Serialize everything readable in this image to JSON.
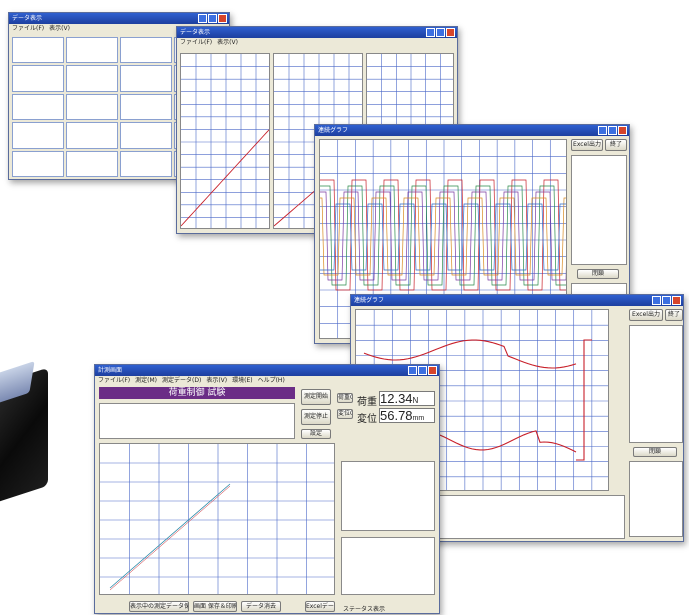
{
  "colors": {
    "title_blue": "#1d3f9f",
    "banner_purple": "#6b2d86",
    "line_red": "#c8202a",
    "line_green": "#2a8a4a",
    "grid_blue": "#4a68c8"
  },
  "win1": {
    "title": "データ表示",
    "menu": [
      "ファイル(F)",
      "表示(V)"
    ]
  },
  "win2": {
    "title": "データ表示",
    "menu": [
      "ファイル(F)",
      "表示(V)"
    ]
  },
  "win3": {
    "title": "連続グラフ",
    "excel_button": "Excel出力",
    "end_button": "終了",
    "apply_button": "閉鎖"
  },
  "win4": {
    "title": "連続グラフ",
    "excel_button": "Excel出力",
    "end_button": "終了",
    "apply_button": "閉鎖"
  },
  "win5": {
    "title": "計測画面",
    "menu": [
      "ファイル(F)",
      "測定(M)",
      "測定データ(D)",
      "表示(V)",
      "環境(E)",
      "ヘルプ(H)"
    ],
    "banner": "荷重制御 試験",
    "buttons": {
      "start": "測定開始",
      "stop": "測定停止",
      "zero1": "荷重0",
      "zero2": "変位0",
      "settings": "設定",
      "save": "表示中の測定データ保存",
      "graph": "画面 保存＆印刷",
      "clear": "データ消去",
      "excel": "Excelデータ"
    },
    "load_label": "荷重",
    "load_value": "12.34",
    "load_unit": "N",
    "disp_label": "変位",
    "disp_value": "56.78",
    "disp_unit": "mm",
    "status": "ステータス表示"
  }
}
